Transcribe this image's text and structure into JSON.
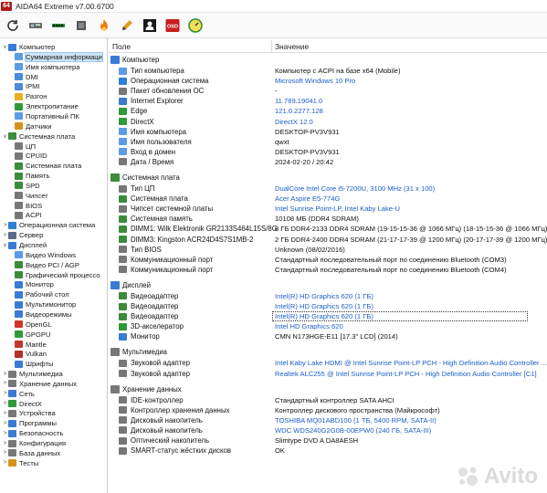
{
  "window": {
    "title": "AIDA64 Extreme v7.00.6700",
    "icon_text": "64"
  },
  "toolbar": {
    "buttons": [
      "refresh-icon",
      "motherboard-icon",
      "memory-icon",
      "processor-icon",
      "flame-icon",
      "pencil-icon",
      "person-icon",
      "osd-icon",
      "gauge-icon"
    ],
    "osd_label": "OSD"
  },
  "tree": {
    "items": [
      {
        "label": "Компьютер",
        "level": 0,
        "exp": "∨",
        "color": "#3a7bd5"
      },
      {
        "label": "Суммарная информаци",
        "level": 1,
        "exp": "",
        "color": "#5c9be6",
        "selected": true
      },
      {
        "label": "Имя компьютера",
        "level": 1,
        "exp": "",
        "color": "#5c9be6"
      },
      {
        "label": "DMI",
        "level": 1,
        "exp": "",
        "color": "#4a8ad8"
      },
      {
        "label": "IPMI",
        "level": 1,
        "exp": "",
        "color": "#4a8ad8"
      },
      {
        "label": "Разгон",
        "level": 1,
        "exp": "",
        "color": "#e6b220"
      },
      {
        "label": "Электропитание",
        "level": 1,
        "exp": "",
        "color": "#2f9a3a"
      },
      {
        "label": "Портативный ПК",
        "level": 1,
        "exp": "",
        "color": "#5c9be6"
      },
      {
        "label": "Датчики",
        "level": 1,
        "exp": "",
        "color": "#d6931a"
      },
      {
        "label": "Системная плата",
        "level": 0,
        "exp": "∨",
        "color": "#3b8c3b"
      },
      {
        "label": "ЦП",
        "level": 1,
        "exp": "",
        "color": "#777"
      },
      {
        "label": "CPUID",
        "level": 1,
        "exp": "",
        "color": "#777"
      },
      {
        "label": "Системная плата",
        "level": 1,
        "exp": "",
        "color": "#3b8c3b"
      },
      {
        "label": "Память",
        "level": 1,
        "exp": "",
        "color": "#3b8c3b"
      },
      {
        "label": "SPD",
        "level": 1,
        "exp": "",
        "color": "#3b8c3b"
      },
      {
        "label": "Чипсет",
        "level": 1,
        "exp": "",
        "color": "#777"
      },
      {
        "label": "BIOS",
        "level": 1,
        "exp": "",
        "color": "#777"
      },
      {
        "label": "ACPI",
        "level": 1,
        "exp": "",
        "color": "#777"
      },
      {
        "label": "Операционная система",
        "level": 0,
        "exp": ">",
        "color": "#2d7fd4"
      },
      {
        "label": "Сервер",
        "level": 0,
        "exp": ">",
        "color": "#5a6e8a"
      },
      {
        "label": "Дисплей",
        "level": 0,
        "exp": "∨",
        "color": "#3a7bd5"
      },
      {
        "label": "Видео Windows",
        "level": 1,
        "exp": "",
        "color": "#5c9be6"
      },
      {
        "label": "Видео PCI / AGP",
        "level": 1,
        "exp": "",
        "color": "#3b8c3b"
      },
      {
        "label": "Графический процессо",
        "level": 1,
        "exp": "",
        "color": "#3b8c3b"
      },
      {
        "label": "Монитор",
        "level": 1,
        "exp": "",
        "color": "#3a7bd5"
      },
      {
        "label": "Рабочий стол",
        "level": 1,
        "exp": "",
        "color": "#3a7bd5"
      },
      {
        "label": "Мультимонитор",
        "level": 1,
        "exp": "",
        "color": "#3a7bd5"
      },
      {
        "label": "Видеорежимы",
        "level": 1,
        "exp": "",
        "color": "#3a7bd5"
      },
      {
        "label": "OpenGL",
        "level": 1,
        "exp": "",
        "color": "#d0342c"
      },
      {
        "label": "GPGPU",
        "level": 1,
        "exp": "",
        "color": "#2f9a3a"
      },
      {
        "label": "Mantle",
        "level": 1,
        "exp": "",
        "color": "#c0392b"
      },
      {
        "label": "Vulkan",
        "level": 1,
        "exp": "",
        "color": "#b0302a"
      },
      {
        "label": "Шрифты",
        "level": 1,
        "exp": "",
        "color": "#3a7bd5"
      },
      {
        "label": "Мультимедиа",
        "level": 0,
        "exp": ">",
        "color": "#777"
      },
      {
        "label": "Хранение данных",
        "level": 0,
        "exp": ">",
        "color": "#777"
      },
      {
        "label": "Сеть",
        "level": 0,
        "exp": ">",
        "color": "#3a7bd5"
      },
      {
        "label": "DirectX",
        "level": 0,
        "exp": ">",
        "color": "#2f9a3a"
      },
      {
        "label": "Устройства",
        "level": 0,
        "exp": ">",
        "color": "#777"
      },
      {
        "label": "Программы",
        "level": 0,
        "exp": ">",
        "color": "#3a7bd5"
      },
      {
        "label": "Безопасность",
        "level": 0,
        "exp": ">",
        "color": "#3a7bd5"
      },
      {
        "label": "Конфигурация",
        "level": 0,
        "exp": ">",
        "color": "#777"
      },
      {
        "label": "База данных",
        "level": 0,
        "exp": ">",
        "color": "#777"
      },
      {
        "label": "Тесты",
        "level": 0,
        "exp": ">",
        "color": "#d6931a"
      }
    ]
  },
  "header": {
    "field": "Поле",
    "value": "Значение"
  },
  "rows": [
    {
      "type": "sect",
      "field": "Компьютер",
      "color": "#3a7bd5"
    },
    {
      "field": "Тип компьютера",
      "value": "Компьютер с ACPI на базе x64  (Mobile)",
      "color": "#5c9be6"
    },
    {
      "field": "Операционная система",
      "value": "Microsoft Windows 10 Pro",
      "link": true,
      "color": "#2d7fd4"
    },
    {
      "field": "Пакет обновления ОС",
      "value": "-",
      "color": "#777"
    },
    {
      "field": "Internet Explorer",
      "value": "11.789.19041.0",
      "link": true,
      "color": "#3a7bd5"
    },
    {
      "field": "Edge",
      "value": "121.0.2277.128",
      "link": true,
      "color": "#2f9a3a"
    },
    {
      "field": "DirectX",
      "value": "DirectX 12.0",
      "link": true,
      "color": "#2f9a3a"
    },
    {
      "field": "Имя компьютера",
      "value": "DESKTOP-PV3V931",
      "color": "#5c9be6"
    },
    {
      "field": "Имя пользователя",
      "value": "qwxt",
      "color": "#5c9be6"
    },
    {
      "field": "Вход в домен",
      "value": "DESKTOP-PV3V931",
      "color": "#5c9be6"
    },
    {
      "field": "Дата / Время",
      "value": "2024-02-20 / 20:42",
      "color": "#777"
    },
    {
      "type": "gap"
    },
    {
      "type": "sect",
      "field": "Системная плата",
      "color": "#3b8c3b"
    },
    {
      "field": "Тип ЦП",
      "value": "DualCore Intel Core i5-7200U, 3100 MHz (31 x 100)",
      "link": true,
      "color": "#777"
    },
    {
      "field": "Системная плата",
      "value": "Acer Aspire E5-774G",
      "link": true,
      "color": "#3b8c3b"
    },
    {
      "field": "Чипсет системной платы",
      "value": "Intel Sunrise Point-LP, Intel Kaby Lake-U",
      "link": true,
      "color": "#777"
    },
    {
      "field": "Системная память",
      "value": "10108 МБ  (DDR4 SDRAM)",
      "color": "#3b8c3b"
    },
    {
      "field": "DIMM1: Wilk Elektronik GR2133S464L15S/8G",
      "value": "8 ГБ DDR4-2133 DDR4 SDRAM  (19-15-15-36 @ 1066 МГц)  (18-15-15-36 @ 1066 МГц)",
      "color": "#3b8c3b"
    },
    {
      "field": "DIMM3: Kingston ACR24D4S7S1MB-2",
      "value": "2 ГБ DDR4-2400 DDR4 SDRAM  (21-17-17-39 @ 1200 МГц)  (20-17-17-39 @ 1200 МГц)",
      "color": "#3b8c3b"
    },
    {
      "field": "Тип BIOS",
      "value": "Unknown (08/02/2016)",
      "color": "#777"
    },
    {
      "field": "Коммуникационный порт",
      "value": "Стандартный последовательный порт по соединению Bluetooth (COM3)",
      "color": "#777"
    },
    {
      "field": "Коммуникационный порт",
      "value": "Стандартный последовательный порт по соединению Bluetooth (COM4)",
      "color": "#777"
    },
    {
      "type": "gap"
    },
    {
      "type": "sect",
      "field": "Дисплей",
      "color": "#3a7bd5"
    },
    {
      "field": "Видеоадаптер",
      "value": "Intel(R) HD Graphics 620  (1 ГБ)",
      "link": true,
      "color": "#3b8c3b"
    },
    {
      "field": "Видеоадаптер",
      "value": "Intel(R) HD Graphics 620  (1 ГБ)",
      "link": true,
      "color": "#3b8c3b"
    },
    {
      "field": "Видеоадаптер",
      "value": "Intel(R) HD Graphics 620  (1 ГБ)",
      "link": true,
      "color": "#3b8c3b",
      "highlight": true
    },
    {
      "field": "3D-акселератор",
      "value": "Intel HD Graphics 620",
      "link": true,
      "color": "#2f9a3a"
    },
    {
      "field": "Монитор",
      "value": "CMN N173HGE-E11  [17.3\" LCD]  (2014)",
      "color": "#3a7bd5"
    },
    {
      "type": "gap"
    },
    {
      "type": "sect",
      "field": "Мультимедиа",
      "color": "#777"
    },
    {
      "field": "Звуковой адаптер",
      "value": "Intel Kaby Lake HDMI @ Intel Sunrise Point-LP PCH - High Definition Audio Controller ...",
      "link": true,
      "color": "#777"
    },
    {
      "field": "Звуковой адаптер",
      "value": "Realtek ALC255 @ Intel Sunrise Point-LP PCH - High Definition Audio Controller [C1]",
      "link": true,
      "color": "#777"
    },
    {
      "type": "gap"
    },
    {
      "type": "sect",
      "field": "Хранение данных",
      "color": "#777"
    },
    {
      "field": "IDE-контроллер",
      "value": "Стандартный контроллер SATA AHCI",
      "color": "#777"
    },
    {
      "field": "Контроллер хранения данных",
      "value": "Контроллер дискового пространства (Майкрософт)",
      "color": "#777"
    },
    {
      "field": "Дисковый накопитель",
      "value": "TOSHIBA MQ01ABD100  (1 ТБ, 5400 RPM, SATA-II)",
      "link": true,
      "color": "#777"
    },
    {
      "field": "Дисковый накопитель",
      "value": "WDC WDS240G2G0B-00EPW0  (240 ГБ, SATA-III)",
      "link": true,
      "color": "#777"
    },
    {
      "field": "Оптический накопитель",
      "value": "Slimtype DVD A  DA8AESH",
      "color": "#777"
    },
    {
      "field": "SMART-статус жёстких дисков",
      "value": "OK",
      "color": "#777"
    }
  ],
  "watermark": "Avito"
}
